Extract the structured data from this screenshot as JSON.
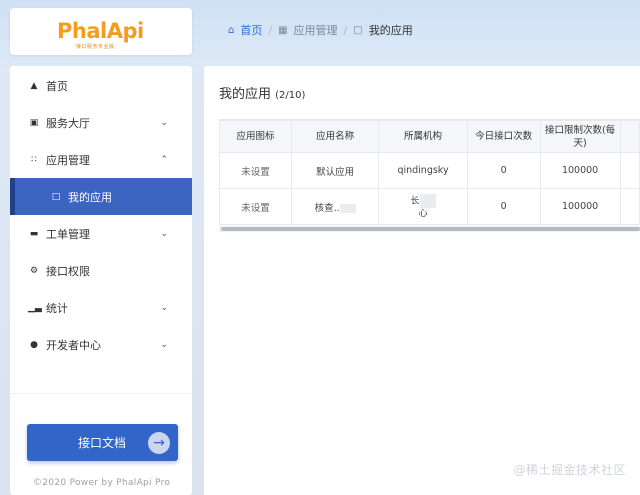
{
  "logo": {
    "text": "PhalApi",
    "subtitle": "接口服务专业版"
  },
  "breadcrumb": {
    "home": "首页",
    "middle": "应用管理",
    "current": "我的应用"
  },
  "sidebar": {
    "items": [
      {
        "label": "首页",
        "icon": "home-icon"
      },
      {
        "label": "服务大厅",
        "icon": "cart-icon",
        "chevron": "down"
      },
      {
        "label": "应用管理",
        "icon": "grid-icon",
        "chevron": "up"
      },
      {
        "label": "我的应用",
        "icon": "window-icon",
        "active": true
      },
      {
        "label": "工单管理",
        "icon": "ticket-icon",
        "chevron": "down"
      },
      {
        "label": "接口权限",
        "icon": "gear-icon"
      },
      {
        "label": "统计",
        "icon": "bar-chart-icon",
        "chevron": "down"
      },
      {
        "label": "开发者中心",
        "icon": "user-icon",
        "chevron": "down"
      }
    ],
    "doc_button": "接口文档",
    "copyright": "©2020 Power by PhalApi Pro"
  },
  "main": {
    "title": "我的应用",
    "count": "(2/10)",
    "table": {
      "headers": [
        "应用图标",
        "应用名称",
        "所属机构",
        "今日接口次数",
        "接口限制次数(每天)"
      ],
      "rows": [
        {
          "icon": "未设置",
          "name": "默认应用",
          "org": "qindingsky",
          "today": "0",
          "limit": "100000"
        },
        {
          "icon": "未设置",
          "name": "核查",
          "org_a": "长",
          "org_b": "心",
          "today": "0",
          "limit": "100000"
        }
      ]
    }
  },
  "watermark": "@稀土掘金技术社区",
  "colors": {
    "accent": "#3165c8",
    "active_nav": "#3b64c1",
    "logo_orange": "#f39c1f"
  }
}
